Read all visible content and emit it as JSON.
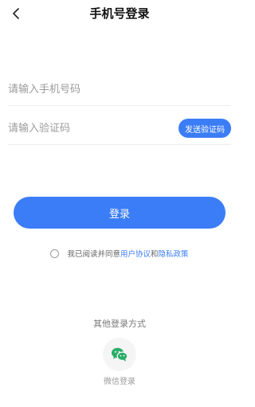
{
  "header": {
    "title": "手机号登录",
    "back_icon": "chevron-left-icon"
  },
  "form": {
    "phone_placeholder": "请输入手机号码",
    "phone_value": "",
    "code_placeholder": "请输入验证码",
    "code_value": "",
    "send_code_label": "发送验证码"
  },
  "login_button": "登录",
  "agreement": {
    "checked": false,
    "prefix": "我已阅读并同意",
    "user_agreement": "用户协议",
    "and": "和",
    "privacy_policy": "隐私政策"
  },
  "other_login": {
    "title": "其他登录方式",
    "wechat_label": "微信登录",
    "wechat_icon": "wechat-icon"
  },
  "colors": {
    "accent": "#3b7df6",
    "wechat_green": "#2aae67"
  }
}
